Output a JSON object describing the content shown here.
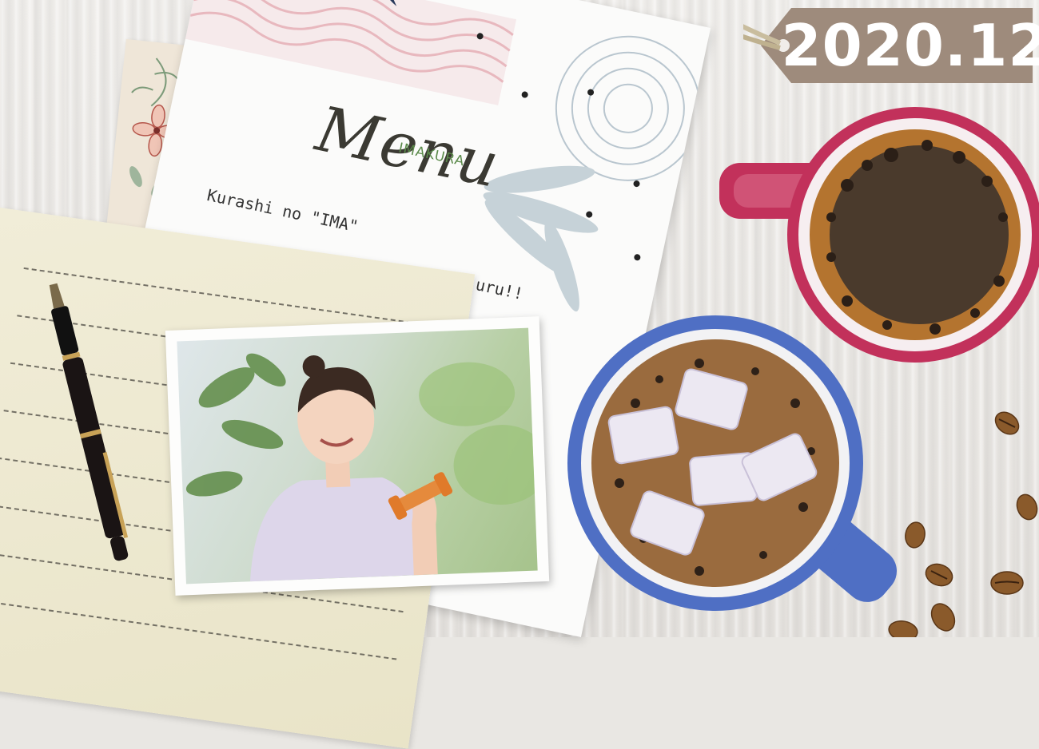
{
  "menu_card": {
    "script_title": "Menu",
    "brand": "IMAKURA",
    "tagline_visible_start": "Kurashi no \"IMA\"",
    "tagline_visible_end": "uru!!"
  },
  "date_tag": {
    "label": "2020.12"
  },
  "colors": {
    "tag": "#9e8b7c",
    "mug_red": "#c2315b",
    "mug_blue": "#4f6fc4",
    "brand_green": "#5b8a4a"
  }
}
